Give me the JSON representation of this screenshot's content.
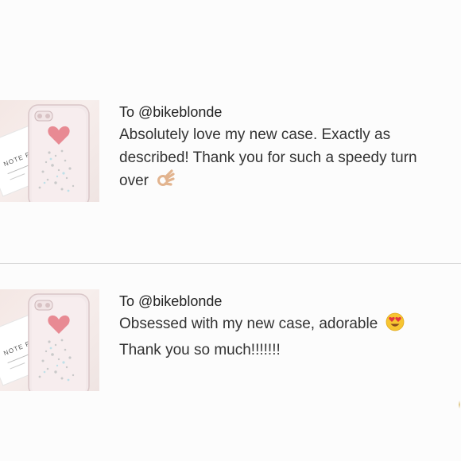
{
  "reviews": [
    {
      "recipient": "To @bikeblonde",
      "message_lines": [
        "Absolutely love my new case. Exactly as",
        "described! Thank you for such a speedy turn",
        "over"
      ],
      "trailing_emoji": "ok-hand-emoji",
      "thumbnail": {
        "card_text": "NOTE FO"
      }
    },
    {
      "recipient": "To @bikeblonde",
      "message_lines": [
        "Obsessed with my new case, adorable",
        "Thank you so much!!!!!!!"
      ],
      "trailing_emoji": "heart-eyes-emoji",
      "thumbnail": {
        "card_text": "NOTE FO"
      }
    }
  ],
  "colors": {
    "background": "#fcfcfc",
    "text": "#333333",
    "divider": "#d9d9d9",
    "heart_pink": "#e88a93"
  }
}
